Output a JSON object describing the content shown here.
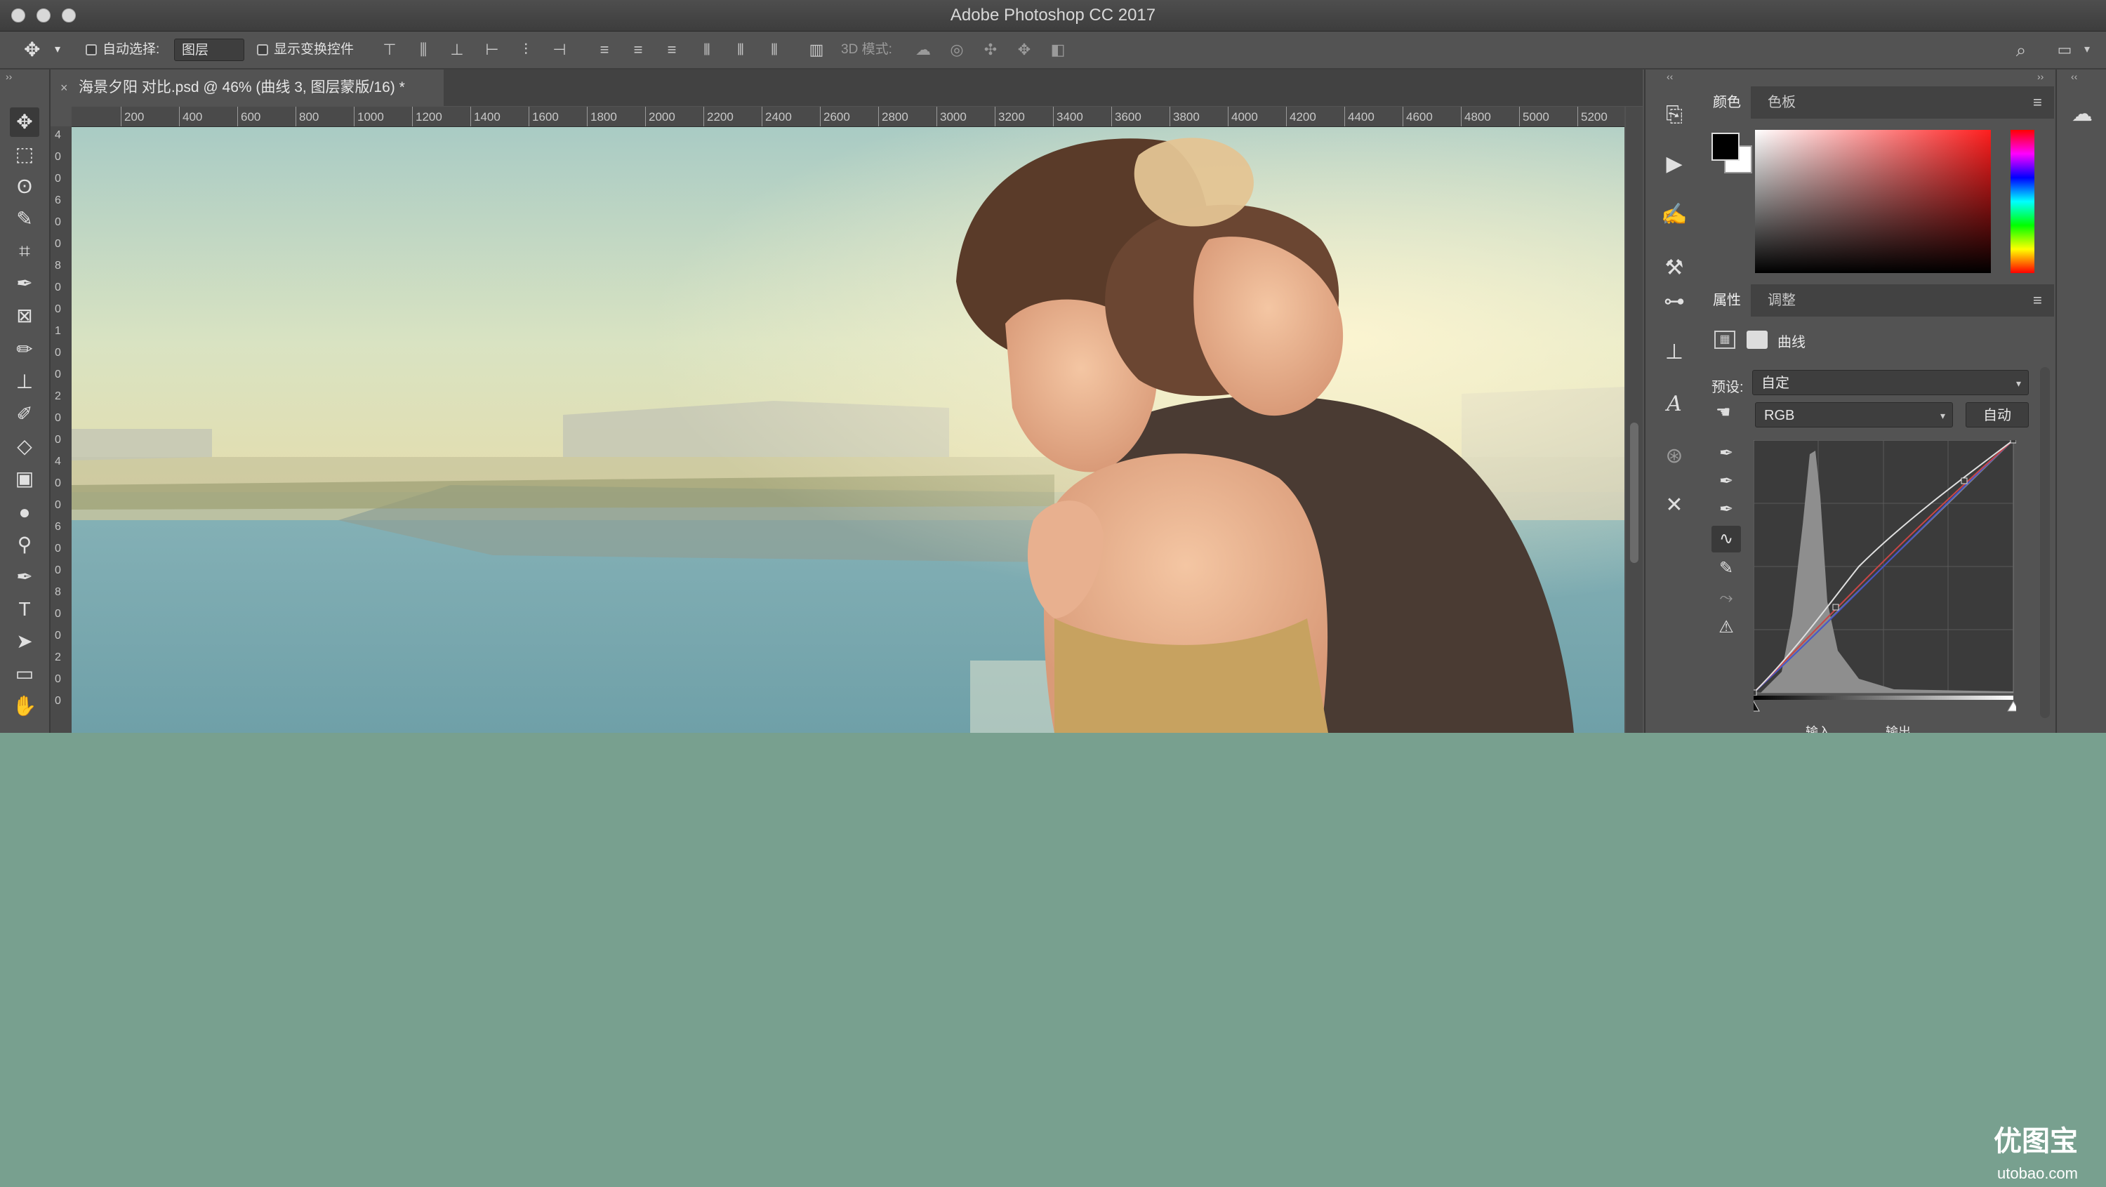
{
  "window": {
    "title": "Adobe Photoshop CC 2017"
  },
  "options_bar": {
    "auto_select_label": "自动选择:",
    "auto_select_value": "图层",
    "show_transform_label": "显示变换控件",
    "mode_3d_label": "3D 模式:"
  },
  "document": {
    "tab_title": "海景夕阳 对比.psd @ 46% (曲线 3, 图层蒙版/16) *",
    "zoom": "46%",
    "ruler_h": [
      "200",
      "400",
      "600",
      "800",
      "1000",
      "1200",
      "1400",
      "1600",
      "1800",
      "2000",
      "2200",
      "2400",
      "2600",
      "2800",
      "3000",
      "3200",
      "3400",
      "3600",
      "3800",
      "4000",
      "4200",
      "4400",
      "4600",
      "4800",
      "5000",
      "5200"
    ],
    "ruler_v": [
      "4",
      "0",
      "0",
      "6",
      "0",
      "0",
      "8",
      "0",
      "0",
      "1",
      "0",
      "0",
      "2",
      "0",
      "0",
      "4",
      "0",
      "0",
      "6",
      "0",
      "0",
      "8",
      "0",
      "0",
      "2",
      "0",
      "0"
    ]
  },
  "color_panel": {
    "tabs": [
      "颜色",
      "色板"
    ],
    "fg_color": "#000000",
    "bg_color": "#ffffff",
    "hue_color": "#ff1e1e"
  },
  "properties_panel": {
    "tabs": [
      "属性",
      "调整"
    ],
    "title": "曲线",
    "preset_label": "预设:",
    "preset_value": "自定",
    "channel_value": "RGB",
    "auto_button": "自动",
    "bottom_labels": [
      "输入",
      "输出"
    ]
  },
  "watermark": {
    "text": "优图宝",
    "sub": "utobao.com"
  },
  "colors": {
    "ui_bg": "#535353",
    "dark": "#424242",
    "page_bg": "#78a08f"
  },
  "icons": {
    "toolbar": [
      "move-icon",
      "marquee-icon",
      "lasso-icon",
      "quick-select-icon",
      "crop-icon",
      "eyedropper-icon",
      "frame-icon",
      "brush-icon",
      "stamp-icon",
      "history-brush-icon",
      "eraser-icon",
      "gradient-icon",
      "blur-icon",
      "dodge-icon",
      "pen-icon",
      "type-icon",
      "path-select-icon",
      "rectangle-icon",
      "hand-icon"
    ],
    "dock": [
      "history-icon",
      "play-icon",
      "brush-settings-icon",
      "clone-source-icon",
      "adjust-icon",
      "stamp-panel-icon",
      "character-icon",
      "paragraph-icon",
      "tools-icon"
    ]
  }
}
